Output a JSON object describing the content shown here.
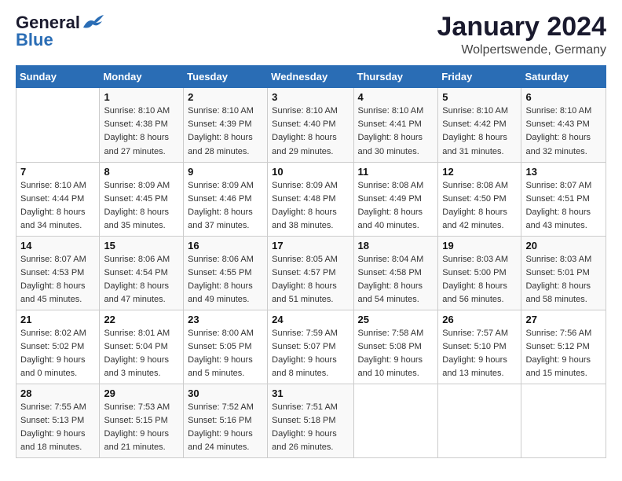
{
  "header": {
    "logo_line1": "General",
    "logo_line2": "Blue",
    "month_title": "January 2024",
    "location": "Wolpertswende, Germany"
  },
  "days_of_week": [
    "Sunday",
    "Monday",
    "Tuesday",
    "Wednesday",
    "Thursday",
    "Friday",
    "Saturday"
  ],
  "weeks": [
    [
      {
        "day": "",
        "info": ""
      },
      {
        "day": "1",
        "info": "Sunrise: 8:10 AM\nSunset: 4:38 PM\nDaylight: 8 hours\nand 27 minutes."
      },
      {
        "day": "2",
        "info": "Sunrise: 8:10 AM\nSunset: 4:39 PM\nDaylight: 8 hours\nand 28 minutes."
      },
      {
        "day": "3",
        "info": "Sunrise: 8:10 AM\nSunset: 4:40 PM\nDaylight: 8 hours\nand 29 minutes."
      },
      {
        "day": "4",
        "info": "Sunrise: 8:10 AM\nSunset: 4:41 PM\nDaylight: 8 hours\nand 30 minutes."
      },
      {
        "day": "5",
        "info": "Sunrise: 8:10 AM\nSunset: 4:42 PM\nDaylight: 8 hours\nand 31 minutes."
      },
      {
        "day": "6",
        "info": "Sunrise: 8:10 AM\nSunset: 4:43 PM\nDaylight: 8 hours\nand 32 minutes."
      }
    ],
    [
      {
        "day": "7",
        "info": "Sunrise: 8:10 AM\nSunset: 4:44 PM\nDaylight: 8 hours\nand 34 minutes."
      },
      {
        "day": "8",
        "info": "Sunrise: 8:09 AM\nSunset: 4:45 PM\nDaylight: 8 hours\nand 35 minutes."
      },
      {
        "day": "9",
        "info": "Sunrise: 8:09 AM\nSunset: 4:46 PM\nDaylight: 8 hours\nand 37 minutes."
      },
      {
        "day": "10",
        "info": "Sunrise: 8:09 AM\nSunset: 4:48 PM\nDaylight: 8 hours\nand 38 minutes."
      },
      {
        "day": "11",
        "info": "Sunrise: 8:08 AM\nSunset: 4:49 PM\nDaylight: 8 hours\nand 40 minutes."
      },
      {
        "day": "12",
        "info": "Sunrise: 8:08 AM\nSunset: 4:50 PM\nDaylight: 8 hours\nand 42 minutes."
      },
      {
        "day": "13",
        "info": "Sunrise: 8:07 AM\nSunset: 4:51 PM\nDaylight: 8 hours\nand 43 minutes."
      }
    ],
    [
      {
        "day": "14",
        "info": "Sunrise: 8:07 AM\nSunset: 4:53 PM\nDaylight: 8 hours\nand 45 minutes."
      },
      {
        "day": "15",
        "info": "Sunrise: 8:06 AM\nSunset: 4:54 PM\nDaylight: 8 hours\nand 47 minutes."
      },
      {
        "day": "16",
        "info": "Sunrise: 8:06 AM\nSunset: 4:55 PM\nDaylight: 8 hours\nand 49 minutes."
      },
      {
        "day": "17",
        "info": "Sunrise: 8:05 AM\nSunset: 4:57 PM\nDaylight: 8 hours\nand 51 minutes."
      },
      {
        "day": "18",
        "info": "Sunrise: 8:04 AM\nSunset: 4:58 PM\nDaylight: 8 hours\nand 54 minutes."
      },
      {
        "day": "19",
        "info": "Sunrise: 8:03 AM\nSunset: 5:00 PM\nDaylight: 8 hours\nand 56 minutes."
      },
      {
        "day": "20",
        "info": "Sunrise: 8:03 AM\nSunset: 5:01 PM\nDaylight: 8 hours\nand 58 minutes."
      }
    ],
    [
      {
        "day": "21",
        "info": "Sunrise: 8:02 AM\nSunset: 5:02 PM\nDaylight: 9 hours\nand 0 minutes."
      },
      {
        "day": "22",
        "info": "Sunrise: 8:01 AM\nSunset: 5:04 PM\nDaylight: 9 hours\nand 3 minutes."
      },
      {
        "day": "23",
        "info": "Sunrise: 8:00 AM\nSunset: 5:05 PM\nDaylight: 9 hours\nand 5 minutes."
      },
      {
        "day": "24",
        "info": "Sunrise: 7:59 AM\nSunset: 5:07 PM\nDaylight: 9 hours\nand 8 minutes."
      },
      {
        "day": "25",
        "info": "Sunrise: 7:58 AM\nSunset: 5:08 PM\nDaylight: 9 hours\nand 10 minutes."
      },
      {
        "day": "26",
        "info": "Sunrise: 7:57 AM\nSunset: 5:10 PM\nDaylight: 9 hours\nand 13 minutes."
      },
      {
        "day": "27",
        "info": "Sunrise: 7:56 AM\nSunset: 5:12 PM\nDaylight: 9 hours\nand 15 minutes."
      }
    ],
    [
      {
        "day": "28",
        "info": "Sunrise: 7:55 AM\nSunset: 5:13 PM\nDaylight: 9 hours\nand 18 minutes."
      },
      {
        "day": "29",
        "info": "Sunrise: 7:53 AM\nSunset: 5:15 PM\nDaylight: 9 hours\nand 21 minutes."
      },
      {
        "day": "30",
        "info": "Sunrise: 7:52 AM\nSunset: 5:16 PM\nDaylight: 9 hours\nand 24 minutes."
      },
      {
        "day": "31",
        "info": "Sunrise: 7:51 AM\nSunset: 5:18 PM\nDaylight: 9 hours\nand 26 minutes."
      },
      {
        "day": "",
        "info": ""
      },
      {
        "day": "",
        "info": ""
      },
      {
        "day": "",
        "info": ""
      }
    ]
  ]
}
